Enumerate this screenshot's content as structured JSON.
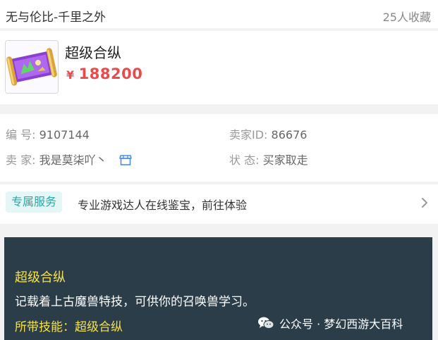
{
  "header": {
    "title": "无与伦比-千里之外",
    "favorites": "25人收藏"
  },
  "item": {
    "name": "超级合纵",
    "currency": "¥",
    "price": "188200",
    "price_color": "#e84b4b"
  },
  "info": {
    "serial_label": "编 号:",
    "serial_value": "9107144",
    "seller_id_label": "卖家ID:",
    "seller_id_value": "86676",
    "seller_label": "卖 家:",
    "seller_value": "我是莫柒吖丶",
    "status_label": "状 态:",
    "status_value": "买家取走"
  },
  "service": {
    "tag": "专属服务",
    "text": "专业游戏达人在线鉴宝，前往体验",
    "accent": "#2aa7a7"
  },
  "tooltip": {
    "title": "超级合纵",
    "description": "记载着上古魔兽特技，可供你的召唤兽学习。",
    "skill": "所带技能：超级合纵",
    "background": "#2b3d48",
    "highlight": "#f5e148"
  },
  "watermark": {
    "text": "公众号 · 梦幻西游大百科",
    "icon": "wechat-icon"
  }
}
